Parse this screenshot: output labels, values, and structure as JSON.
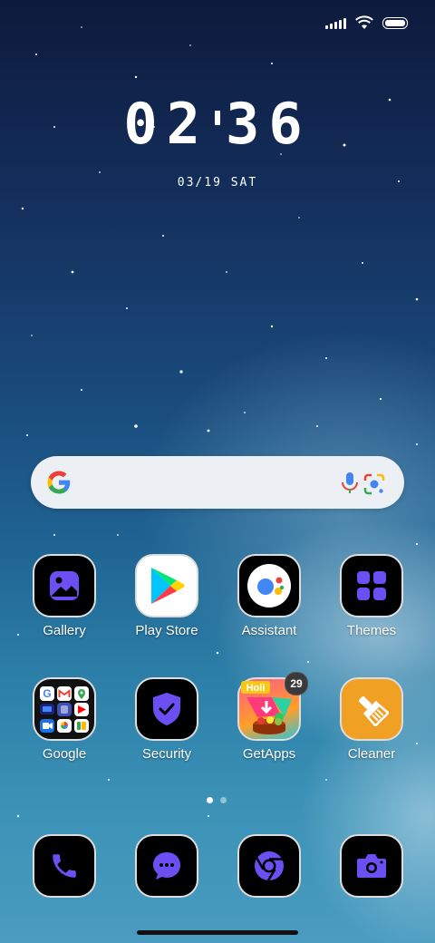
{
  "status_bar": {
    "signal_icon": "signal-icon",
    "wifi_icon": "wifi-icon",
    "battery_icon": "battery-icon"
  },
  "clock": {
    "hours": "02",
    "minutes": "36"
  },
  "date": "03/19 SAT",
  "search": {
    "logo_icon": "google-g-icon",
    "mic_icon": "mic-icon",
    "lens_icon": "lens-icon"
  },
  "apps": [
    {
      "label": "Gallery",
      "icon": "gallery-icon"
    },
    {
      "label": "Play Store",
      "icon": "play-store-icon"
    },
    {
      "label": "Assistant",
      "icon": "assistant-icon"
    },
    {
      "label": "Themes",
      "icon": "themes-icon"
    },
    {
      "label": "Google",
      "icon": "google-folder-icon"
    },
    {
      "label": "Security",
      "icon": "security-icon"
    },
    {
      "label": "GetApps",
      "icon": "getapps-icon",
      "badge": "29",
      "banner": "Holi"
    },
    {
      "label": "Cleaner",
      "icon": "cleaner-icon"
    }
  ],
  "page_indicator": {
    "pages": 2,
    "current": 1
  },
  "dock": [
    {
      "icon": "phone-icon"
    },
    {
      "icon": "messages-icon"
    },
    {
      "icon": "chrome-icon"
    },
    {
      "icon": "camera-icon"
    }
  ],
  "colors": {
    "accent_purple": "#6b4ff2",
    "cleaner_orange": "#f0a023"
  }
}
